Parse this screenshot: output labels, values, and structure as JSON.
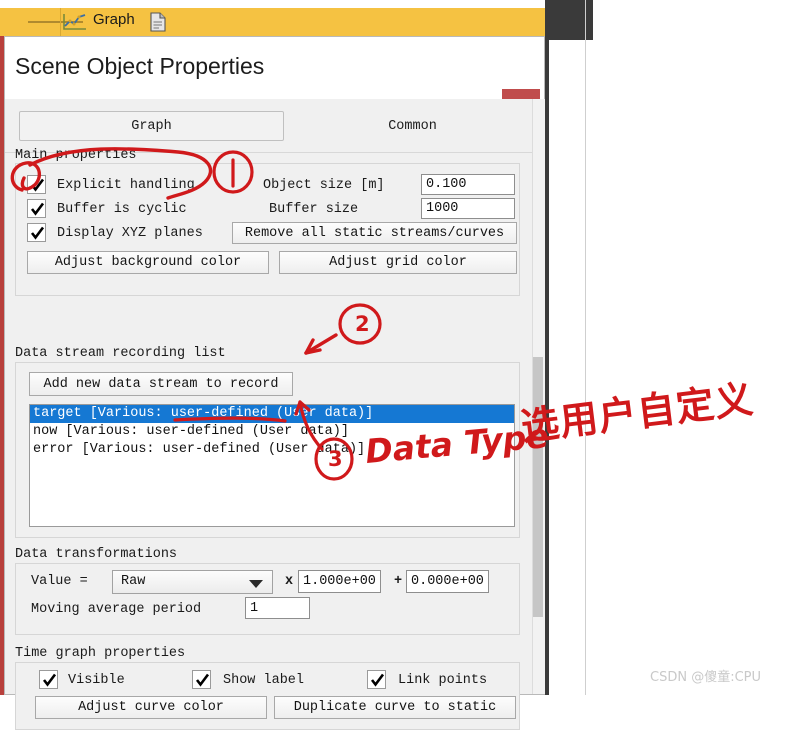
{
  "background": {
    "tab_label": "Graph",
    "graph_icon": "line-chart-icon",
    "doc_icon": "document-icon"
  },
  "dialog": {
    "title": "Scene Object Properties",
    "close_label": "×",
    "tabs": [
      {
        "label": "Graph",
        "active": true
      },
      {
        "label": "Common",
        "active": false
      }
    ],
    "main_properties": {
      "group_label": "Main properties",
      "checkboxes": [
        {
          "label": "Explicit handling",
          "checked": true
        },
        {
          "label": "Buffer is cyclic",
          "checked": true
        },
        {
          "label": "Display XYZ planes",
          "checked": true
        }
      ],
      "fields": [
        {
          "label": "Object size [m]",
          "value": "0.100"
        },
        {
          "label": "Buffer size",
          "value": "1000"
        }
      ],
      "buttons": [
        "Remove all static streams/curves",
        "Adjust background color",
        "Adjust grid color"
      ]
    },
    "data_stream": {
      "group_label": "Data stream recording list",
      "add_button": "Add new data stream to record",
      "items": [
        {
          "text": "target [Various: user-defined (User data)]",
          "selected": true
        },
        {
          "text": "now [Various: user-defined (User data)]",
          "selected": false
        },
        {
          "text": "error [Various: user-defined (User data)]",
          "selected": false
        }
      ]
    },
    "data_transformations": {
      "group_label": "Data transformations",
      "value_label": "Value =",
      "mode": "Raw",
      "multiply_symbol": "x",
      "multiplier": "1.000e+00",
      "plus_symbol": "+",
      "offset": "0.000e+00",
      "moving_avg_label": "Moving average period",
      "moving_avg_value": "1"
    },
    "time_graph": {
      "group_label": "Time graph properties",
      "checkboxes": [
        {
          "label": "Visible",
          "checked": true
        },
        {
          "label": "Show label",
          "checked": true
        },
        {
          "label": "Link points",
          "checked": true
        }
      ],
      "buttons": [
        "Adjust curve color",
        "Duplicate curve to static"
      ]
    }
  },
  "annotations": {
    "marker_1": "1",
    "marker_2": "2",
    "marker_3": "3",
    "data_type_note": "Data Type",
    "chinese_note": "选用户自定义",
    "color": "#d0191b"
  },
  "watermark": "CSDN @傻童:CPU"
}
